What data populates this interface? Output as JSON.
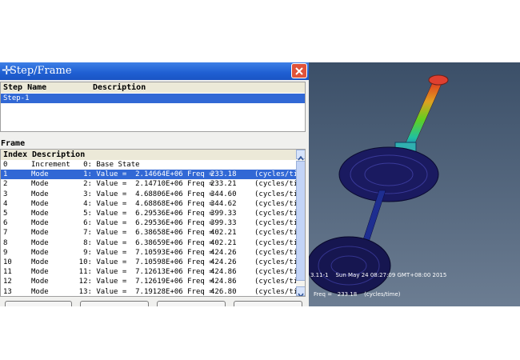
{
  "dialog": {
    "title": "Step/Frame",
    "title_icon": "plus-icon",
    "step_table": {
      "headers": [
        "Step Name",
        "Description"
      ],
      "rows": [
        {
          "name": "Step-1",
          "description": ""
        }
      ]
    },
    "frame_label": "Frame",
    "frame_table": {
      "headers": [
        "Index",
        "Description"
      ],
      "rows": [
        {
          "index": "0",
          "type": "Increment",
          "desc": "     0: Base State",
          "freq": "",
          "unit": ""
        },
        {
          "index": "1",
          "type": "Mode",
          "desc": "     1: Value =  2.14664E+06 Freq =",
          "freq": "233.18",
          "unit": "(cycles/tir"
        },
        {
          "index": "2",
          "type": "Mode",
          "desc": "     2: Value =  2.14710E+06 Freq =",
          "freq": "233.21",
          "unit": "(cycles/tir"
        },
        {
          "index": "3",
          "type": "Mode",
          "desc": "     3: Value =  4.68806E+06 Freq =",
          "freq": "344.60",
          "unit": "(cycles/tir"
        },
        {
          "index": "4",
          "type": "Mode",
          "desc": "     4: Value =  4.68868E+06 Freq =",
          "freq": "344.62",
          "unit": "(cycles/tir"
        },
        {
          "index": "5",
          "type": "Mode",
          "desc": "     5: Value =  6.29536E+06 Freq =",
          "freq": "399.33",
          "unit": "(cycles/tir"
        },
        {
          "index": "6",
          "type": "Mode",
          "desc": "     6: Value =  6.29536E+06 Freq =",
          "freq": "399.33",
          "unit": "(cycles/tir"
        },
        {
          "index": "7",
          "type": "Mode",
          "desc": "     7: Value =  6.38658E+06 Freq =",
          "freq": "402.21",
          "unit": "(cycles/tir"
        },
        {
          "index": "8",
          "type": "Mode",
          "desc": "     8: Value =  6.38659E+06 Freq =",
          "freq": "402.21",
          "unit": "(cycles/tir"
        },
        {
          "index": "9",
          "type": "Mode",
          "desc": "     9: Value =  7.10593E+06 Freq =",
          "freq": "424.26",
          "unit": "(cycles/tir"
        },
        {
          "index": "10",
          "type": "Mode",
          "desc": "    10: Value =  7.10598E+06 Freq =",
          "freq": "424.26",
          "unit": "(cycles/tir"
        },
        {
          "index": "11",
          "type": "Mode",
          "desc": "    11: Value =  7.12613E+06 Freq =",
          "freq": "424.86",
          "unit": "(cycles/tir"
        },
        {
          "index": "12",
          "type": "Mode",
          "desc": "    12: Value =  7.12619E+06 Freq =",
          "freq": "424.86",
          "unit": "(cycles/tir"
        },
        {
          "index": "13",
          "type": "Mode",
          "desc": "    13: Value =  7.19128E+06 Freq =",
          "freq": "426.80",
          "unit": "(cycles/tir"
        }
      ],
      "selected_index": "1"
    }
  },
  "viewport": {
    "status_line": "3.11-1    Sun May 24 08:27:09 GMT+08:00 2015",
    "freq_line": "Freq =   233.18    (cycles/time)"
  },
  "colors": {
    "title_bar": "#1f5fd2",
    "selection": "#3168d5",
    "close_button": "#e0533a",
    "viewport_bg": "#4d6079"
  }
}
